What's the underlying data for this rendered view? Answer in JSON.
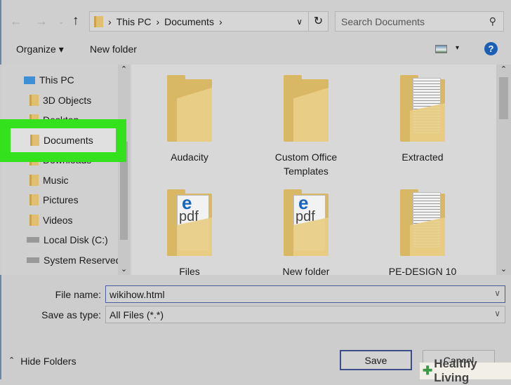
{
  "address": {
    "crumbs": [
      "This PC",
      "Documents"
    ]
  },
  "search": {
    "placeholder": "Search Documents"
  },
  "toolbar": {
    "organize": "Organize",
    "new_folder": "New folder"
  },
  "nav": {
    "items": [
      "This PC",
      "3D Objects",
      "Desktop",
      "Documents",
      "Downloads",
      "Music",
      "Pictures",
      "Videos",
      "Local Disk (C:)",
      "System Reserved"
    ]
  },
  "files": [
    {
      "name": "Audacity",
      "type": "folder"
    },
    {
      "name": "Custom Office Templates",
      "type": "folder"
    },
    {
      "name": "Extracted",
      "type": "folder-docs"
    },
    {
      "name": "Files",
      "type": "folder-pdf"
    },
    {
      "name": "New folder",
      "type": "folder-pdf"
    },
    {
      "name": "PE-DESIGN 10",
      "type": "folder-docs"
    }
  ],
  "pdf_label": "pdf",
  "form": {
    "file_name_label": "File name:",
    "file_name_value": "wikihow.html",
    "type_label": "Save as type:",
    "type_value": "All Files  (*.*)"
  },
  "buttons": {
    "hide_folders": "Hide Folders",
    "save": "Save",
    "cancel": "Cancel"
  },
  "watermark": "Healthy Living",
  "colors": {
    "highlight": "#33e11c",
    "help": "#1a5fb4"
  }
}
